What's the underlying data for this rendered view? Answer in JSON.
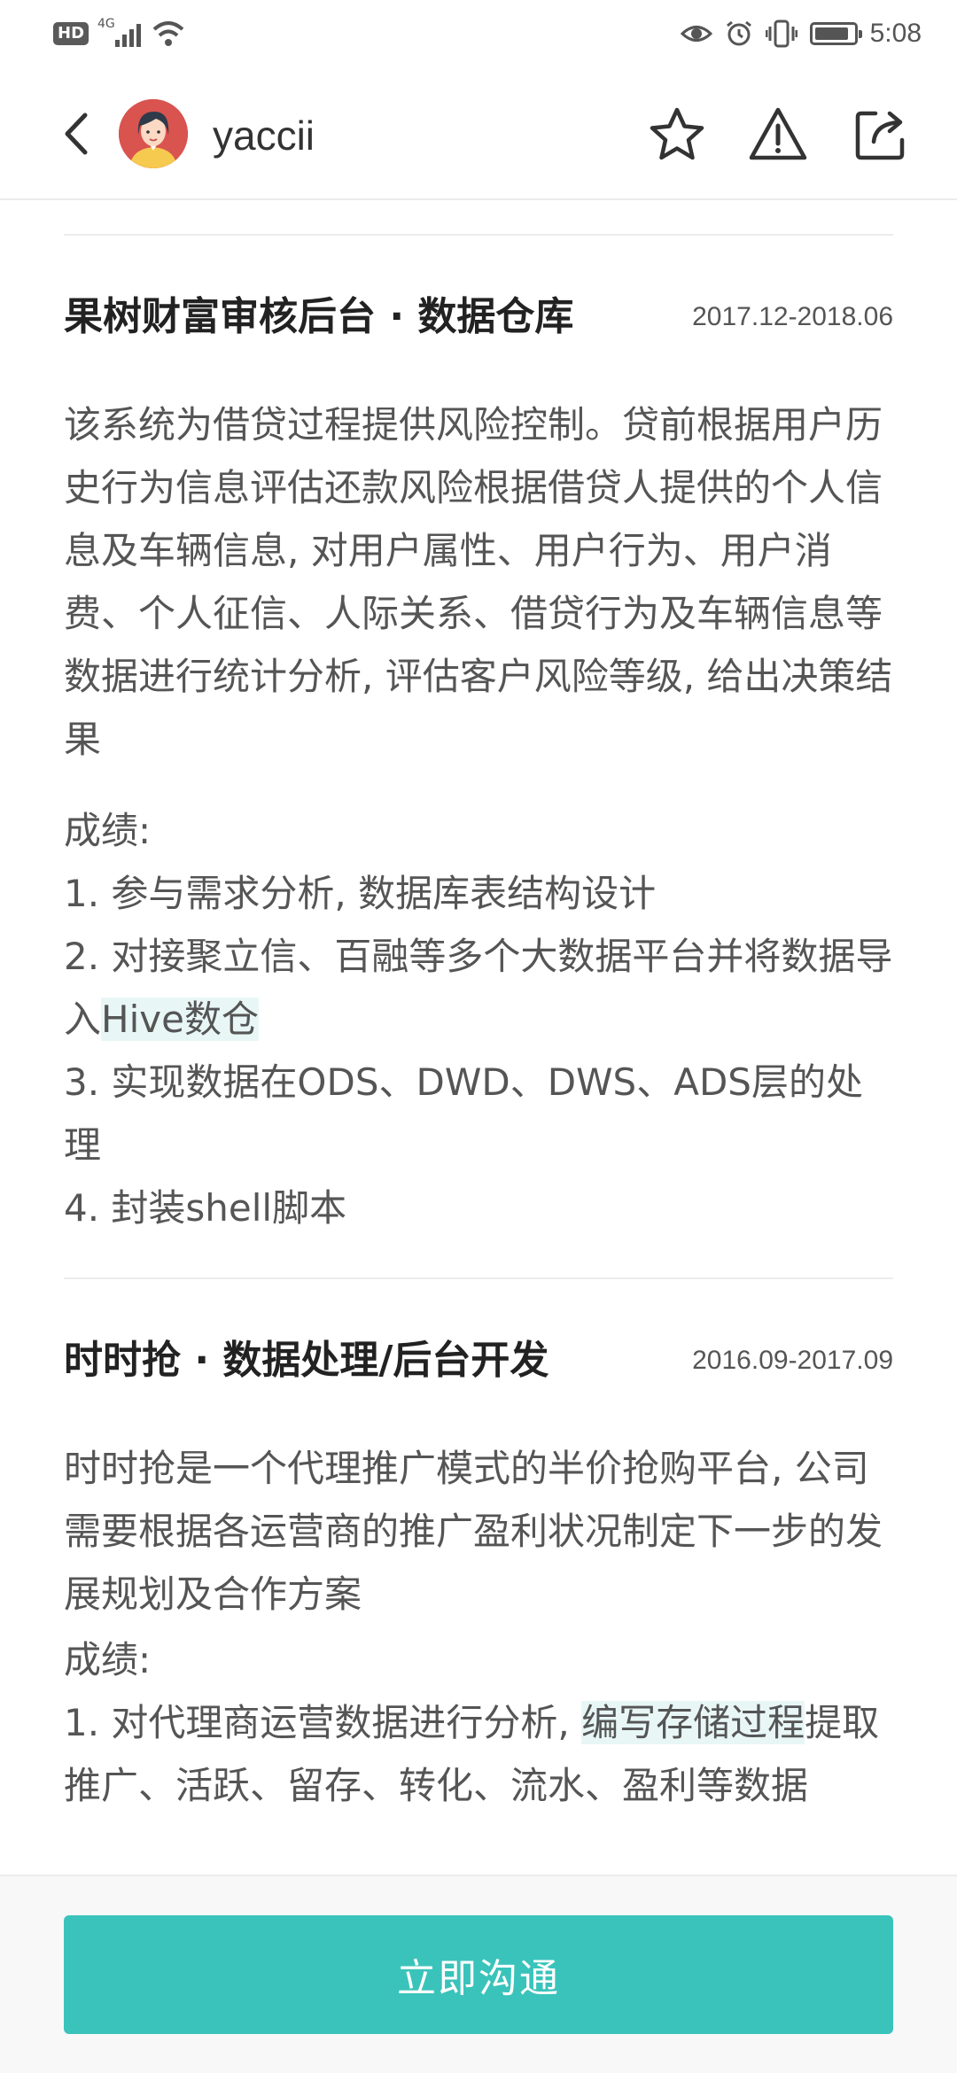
{
  "status_bar": {
    "hd_label": "HD",
    "network_label": "4G",
    "time": "5:08",
    "battery_level": 0.9
  },
  "header": {
    "username": "yaccii"
  },
  "projects": [
    {
      "title": "果树财富审核后台 · 数据仓库",
      "date": "2017.12-2018.06",
      "description": "该系统为借贷过程提供风险控制。贷前根据用户历史行为信息评估还款风险根据借贷人提供的个人信息及车辆信息, 对用户属性、用户行为、用户消费、个人征信、人际关系、借贷行为及车辆信息等数据进行统计分析, 评估客户风险等级, 给出决策结果",
      "achievements_label": "成绩:",
      "items": [
        {
          "text": "1. 参与需求分析, 数据库表结构设计"
        },
        {
          "text_before": "2. 对接聚立信、百融等多个大数据平台并将数据导入",
          "highlight": "Hive数仓",
          "text_after": ""
        },
        {
          "text": "3. 实现数据在ODS、DWD、DWS、ADS层的处理"
        },
        {
          "text": "4. 封装shell脚本"
        }
      ]
    },
    {
      "title": "时时抢 · 数据处理/后台开发",
      "date": "2016.09-2017.09",
      "description": "时时抢是一个代理推广模式的半价抢购平台, 公司需要根据各运营商的推广盈利状况制定下一步的发展规划及合作方案",
      "achievements_label": "成绩:",
      "items": [
        {
          "text_before": "1. 对代理商运营数据进行分析, ",
          "highlight": "编写存储过程",
          "text_after": "提取推广、活跃、留存、转化、流水、盈利等数据"
        }
      ]
    }
  ],
  "footer": {
    "chat_button_label": "立即沟通"
  },
  "colors": {
    "accent": "#3ac3bb",
    "highlight": "#e8f7f5",
    "avatar_bg": "#d9534f"
  }
}
